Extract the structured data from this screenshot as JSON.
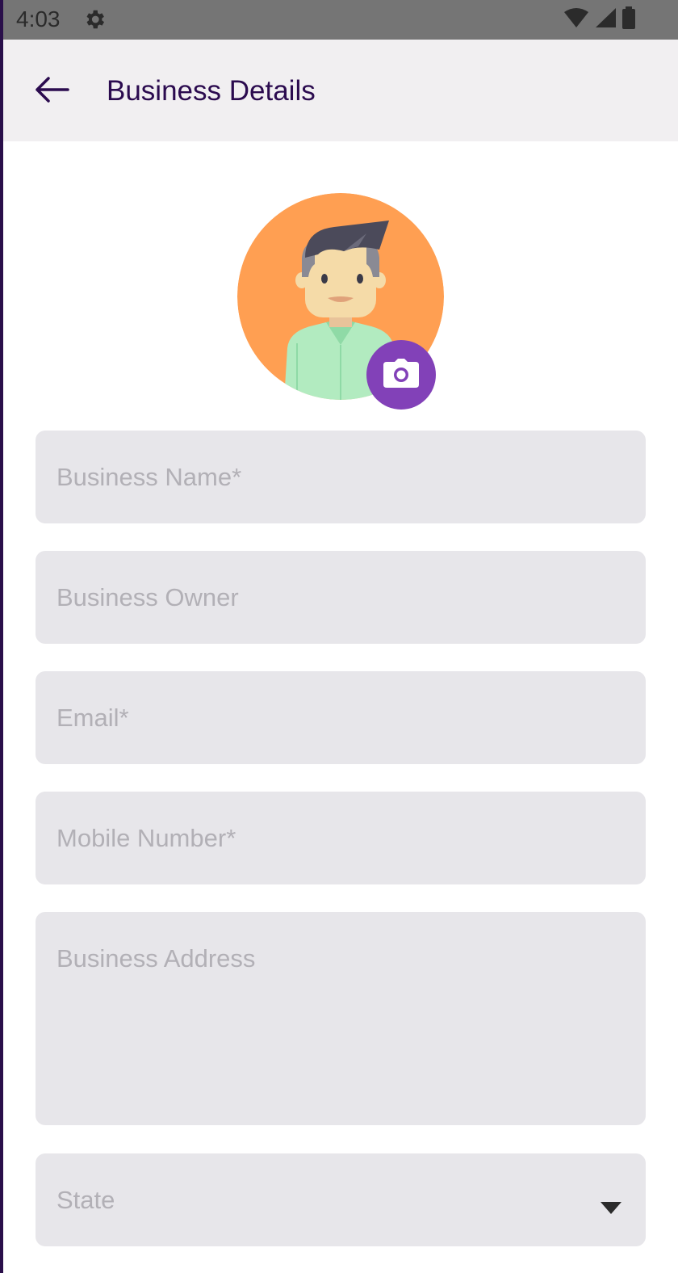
{
  "status_bar": {
    "time": "4:03",
    "icons": [
      "settings-icon",
      "wifi-icon",
      "signal-icon",
      "battery-icon"
    ]
  },
  "app_bar": {
    "title": "Business Details",
    "back_icon": "arrow-left-icon"
  },
  "avatar": {
    "icon": "user-avatar",
    "action_icon": "camera-icon",
    "background_color": "#ff9f52",
    "action_color": "#8241b8"
  },
  "form": {
    "business_name_placeholder": "Business Name*",
    "business_owner_placeholder": "Business Owner",
    "email_placeholder": "Email*",
    "mobile_placeholder": "Mobile Number*",
    "address_placeholder": "Business Address",
    "state_placeholder": "State"
  },
  "colors": {
    "title": "#2b0b4f",
    "field_bg": "#e7e6ea",
    "placeholder": "#b2b0b6"
  }
}
